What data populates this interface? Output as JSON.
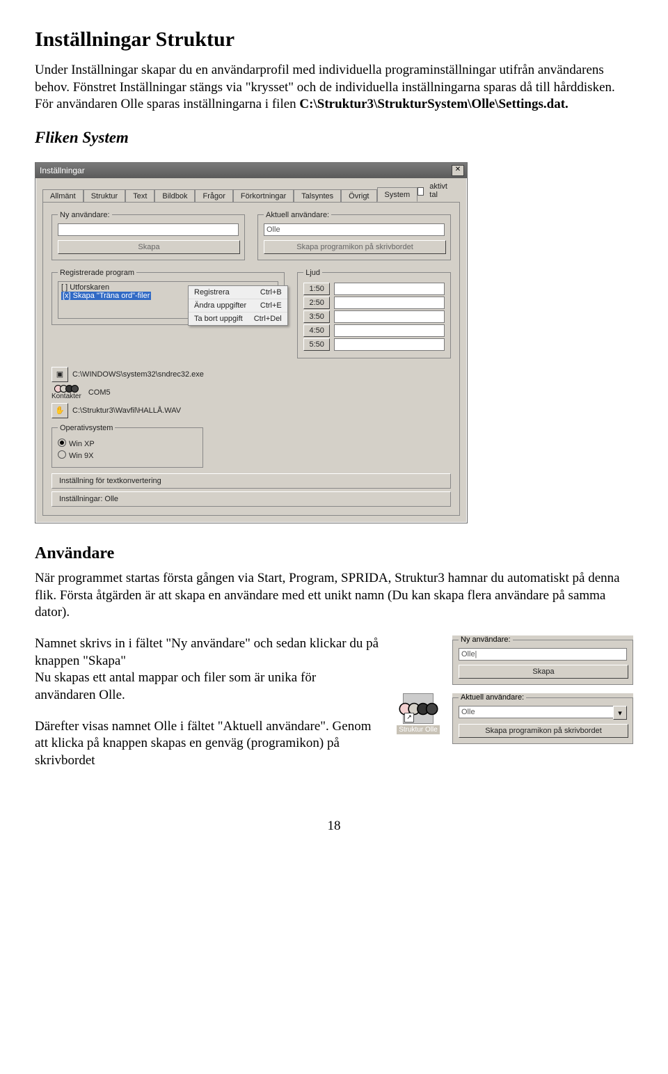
{
  "doc": {
    "h1": "Inställningar Struktur",
    "intro1": "Under Inställningar skapar du en användarprofil med individuella programinställningar utifrån användarens behov. Fönstret Inställningar stängs via \"krysset\" och de individuella inställningarna sparas då till hårddisken. För användaren Olle sparas inställningarna i filen ",
    "intro_path": "C:\\Struktur3\\StrukturSystem\\Olle\\Settings.dat.",
    "h2_fliken": "Fliken System",
    "h2_anv": "Användare",
    "anv_p1": "När programmet startas första gången via Start, Program, SPRIDA, Struktur3 hamnar du automatiskt på denna flik. Första åtgärden är att skapa en användare med ett unikt namn (Du kan skapa flera användare på samma dator).",
    "anv_p2": "Namnet skrivs in i fältet \"Ny användare\" och sedan klickar du på knappen \"Skapa\"",
    "anv_p3": "Nu skapas ett antal mappar och filer som är unika för användaren Olle.",
    "anv_p4": "Därefter visas namnet Olle i fältet \"Aktuell användare\". Genom att klicka på knappen skapas en genväg (programikon) på skrivbordet",
    "page_num": "18"
  },
  "dialog": {
    "title": "Inställningar",
    "tabs": [
      "Allmänt",
      "Struktur",
      "Text",
      "Bildbok",
      "Frågor",
      "Förkortningar",
      "Talsyntes",
      "Övrigt",
      "System"
    ],
    "aktivt_tal": "aktivt tal",
    "ny_anv_legend": "Ny användare:",
    "ny_anv_value": "",
    "skapa_btn": "Skapa",
    "akt_anv_legend": "Aktuell användare:",
    "akt_anv_value": "Olle",
    "skapa_ikon_btn": "Skapa programikon på skrivbordet",
    "reg_legend": "Registrerade program",
    "reg_item1": "[ ] Utforskaren",
    "reg_item2": "[x] Skapa \"Träna ord\"-filer",
    "menu": [
      {
        "label": "Registrera",
        "shortcut": "Ctrl+B"
      },
      {
        "label": "Ändra uppgifter",
        "shortcut": "Ctrl+E"
      },
      {
        "label": "Ta bort uppgift",
        "shortcut": "Ctrl+Del"
      }
    ],
    "ljud_legend": "Ljud",
    "ljud_rows": [
      "1:50",
      "2:50",
      "3:50",
      "4:50",
      "5:50"
    ],
    "path1": "C:\\WINDOWS\\system32\\sndrec32.exe",
    "kontakter_label": "Kontakter",
    "com_label": "COM5",
    "path2": "C:\\Struktur3\\Wavfil\\HALLÅ.WAV",
    "os_legend": "Operativsystem",
    "os_winxp": "Win XP",
    "os_win9x": "Win 9X",
    "btn_textkonv": "Inställning för textkonvertering",
    "btn_inst_olle": "Inställningar: Olle"
  },
  "snip": {
    "ny_legend": "Ny användare:",
    "ny_value": "Olle|",
    "skapa": "Skapa",
    "akt_legend": "Aktuell användare:",
    "akt_value": "Olle",
    "skapa_ikon": "Skapa programikon på skrivbordet",
    "shortcut_caption": "Struktur Olle"
  }
}
